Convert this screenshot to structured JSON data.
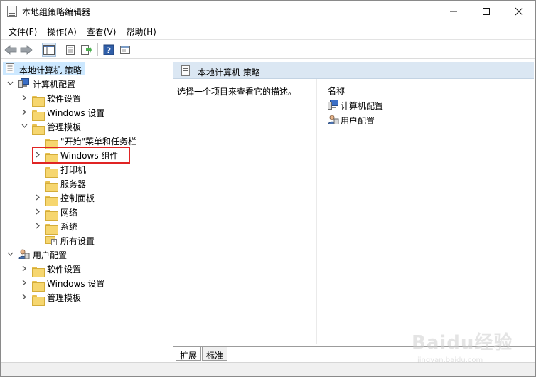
{
  "window": {
    "title": "本地组策略编辑器",
    "controls": {
      "minimize": "minimize",
      "maximize": "maximize",
      "close": "close"
    }
  },
  "menu": [
    {
      "label": "文件(F)"
    },
    {
      "label": "操作(A)"
    },
    {
      "label": "查看(V)"
    },
    {
      "label": "帮助(H)"
    }
  ],
  "toolbar": {
    "icons": [
      "back-arrow-icon",
      "forward-arrow-icon",
      "show-hide-tree-icon",
      "properties-icon",
      "export-list-icon",
      "help-icon",
      "view-icon"
    ]
  },
  "tree": {
    "root": "本地计算机 策略",
    "computer_config": "计算机配置",
    "software_settings": "软件设置",
    "windows_settings": "Windows 设置",
    "admin_templates": "管理模板",
    "start_menu": "\"开始\"菜单和任务栏",
    "windows_components": "Windows 组件",
    "printers": "打印机",
    "server": "服务器",
    "control_panel": "控制面板",
    "network": "网络",
    "system": "系统",
    "all_settings": "所有设置",
    "user_config": "用户配置",
    "user_software_settings": "软件设置",
    "user_windows_settings": "Windows 设置",
    "user_admin_templates": "管理模板"
  },
  "right_pane": {
    "title": "本地计算机 策略",
    "description": "选择一个项目来查看它的描述。",
    "column_name": "名称",
    "items": [
      {
        "label": "计算机配置"
      },
      {
        "label": "用户配置"
      }
    ]
  },
  "tabs": {
    "extended": "扩展",
    "standard": "标准"
  },
  "watermark": {
    "main": "Baidu经验",
    "sub": "jingyan.baidu.com"
  },
  "colors": {
    "selection": "#cce8ff",
    "header_bg": "#dbe7f3",
    "highlight_border": "#e02424",
    "folder": "#f6d66f"
  }
}
